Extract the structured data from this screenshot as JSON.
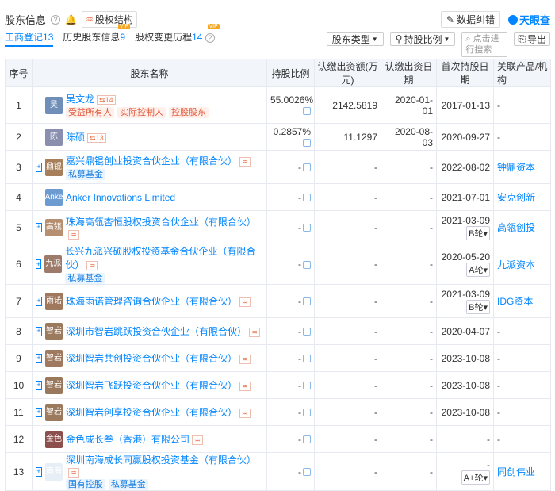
{
  "header": {
    "title": "股东信息",
    "struct_label": "股权结构",
    "error_label": "数据纠错",
    "logo_text": "天眼查"
  },
  "tabs": [
    {
      "label": "工商登记",
      "count": "13"
    },
    {
      "label": "历史股东信息",
      "count": "9"
    },
    {
      "label": "股权变更历程",
      "count": "14"
    }
  ],
  "filters": {
    "type_label": "股东类型",
    "ratio_label": "持股比例",
    "search_placeholder": "点击进行搜索",
    "export_label": "导出"
  },
  "columns": [
    "序号",
    "股东名称",
    "持股比例",
    "认缴出资额(万元)",
    "认缴出资日期",
    "首次持股日期",
    "关联产品/机构"
  ],
  "rows": [
    {
      "no": "1",
      "avatar": "吴",
      "name": "吴文龙",
      "count": "14",
      "tags": [
        "受益所有人",
        "实际控制人",
        "控股股东"
      ],
      "ratio": "55.0026%",
      "amount": "2142.5819",
      "sub_date": "2020-01-01",
      "first_date": "2017-01-13",
      "round": "",
      "product": "-"
    },
    {
      "no": "2",
      "avatar": "陈",
      "name": "陈硕",
      "count": "13",
      "tags": [],
      "ratio": "0.2857%",
      "amount": "11.1297",
      "sub_date": "2020-08-03",
      "first_date": "2020-09-27",
      "round": "",
      "product": "-"
    },
    {
      "no": "3",
      "avatar": "鼎锟",
      "name": "嘉兴鼎锟创业投资合伙企业（有限合伙）",
      "count": "",
      "tags": [
        "私募基金"
      ],
      "ratio": "-",
      "amount": "-",
      "sub_date": "-",
      "first_date": "2022-08-02",
      "round": "",
      "product": "钟鼎资本"
    },
    {
      "no": "4",
      "avatar": "Anke",
      "name": "Anker Innovations Limited",
      "count": "",
      "tags": [],
      "ratio": "-",
      "amount": "-",
      "sub_date": "-",
      "first_date": "2021-07-01",
      "round": "",
      "product": "安克创新"
    },
    {
      "no": "5",
      "avatar": "高瓴",
      "name": "珠海高瓴杏恒股权投资合伙企业（有限合伙）",
      "count": "",
      "tags": [],
      "ratio": "-",
      "amount": "-",
      "sub_date": "-",
      "first_date": "2021-03-09",
      "round": "B轮",
      "product": "高瓴创投"
    },
    {
      "no": "6",
      "avatar": "九派",
      "name": "长兴九派兴硕股权投资基金合伙企业（有限合伙）",
      "count": "",
      "tags": [
        "私募基金"
      ],
      "ratio": "-",
      "amount": "-",
      "sub_date": "-",
      "first_date": "2020-05-20",
      "round": "A轮",
      "product": "九派资本"
    },
    {
      "no": "7",
      "avatar": "雨诺",
      "name": "珠海雨诺管理咨询合伙企业（有限合伙）",
      "count": "",
      "tags": [],
      "ratio": "-",
      "amount": "-",
      "sub_date": "-",
      "first_date": "2021-03-09",
      "round": "B轮",
      "product": "IDG资本"
    },
    {
      "no": "8",
      "avatar": "智岩",
      "name": "深圳市智岩跳跃投资合伙企业（有限合伙）",
      "count": "",
      "tags": [],
      "ratio": "-",
      "amount": "-",
      "sub_date": "-",
      "first_date": "2020-04-07",
      "round": "",
      "product": "-"
    },
    {
      "no": "9",
      "avatar": "智岩",
      "name": "深圳智岩共创投资合伙企业（有限合伙）",
      "count": "",
      "tags": [],
      "ratio": "-",
      "amount": "-",
      "sub_date": "-",
      "first_date": "2023-10-08",
      "round": "",
      "product": "-"
    },
    {
      "no": "10",
      "avatar": "智岩",
      "name": "深圳智岩飞跃投资合伙企业（有限合伙）",
      "count": "",
      "tags": [],
      "ratio": "-",
      "amount": "-",
      "sub_date": "-",
      "first_date": "2023-10-08",
      "round": "",
      "product": "-"
    },
    {
      "no": "11",
      "avatar": "智岩",
      "name": "深圳智岩创享投资合伙企业（有限合伙）",
      "count": "",
      "tags": [],
      "ratio": "-",
      "amount": "-",
      "sub_date": "-",
      "first_date": "2023-10-08",
      "round": "",
      "product": "-"
    },
    {
      "no": "12",
      "avatar": "金色",
      "name": "金色成长叁（香港）有限公司",
      "count": "",
      "tags": [],
      "ratio": "-",
      "amount": "-",
      "sub_date": "-",
      "first_date": "-",
      "round": "",
      "product": "-"
    },
    {
      "no": "13",
      "avatar": "南海",
      "name": "深圳南海成长同赢股权投资基金（有限合伙）",
      "count": "",
      "tags": [
        "国有控股",
        "私募基金"
      ],
      "ratio": "-",
      "amount": "-",
      "sub_date": "-",
      "first_date": "-",
      "round": "A+轮",
      "product": "同创伟业"
    }
  ],
  "colors": {
    "accent": "#0084ff",
    "header_bg": "#f2f6fb",
    "tag_red": "#e25d3e",
    "tag_blue": "#1a7fe0"
  }
}
